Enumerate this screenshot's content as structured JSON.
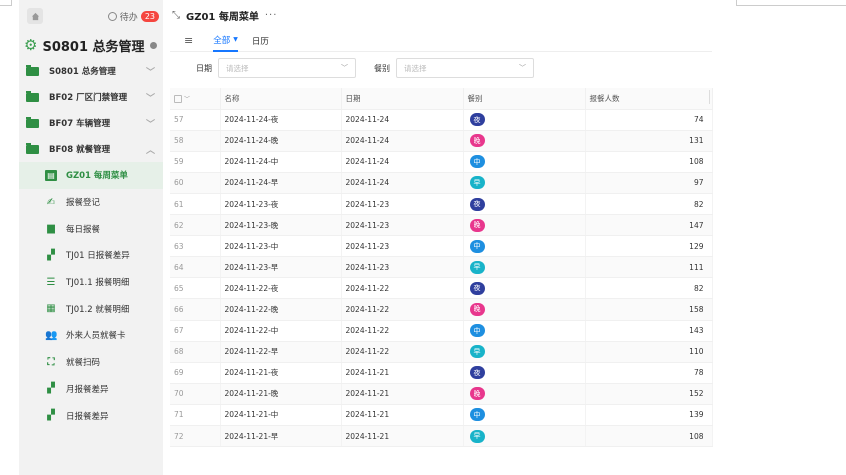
{
  "sidebar": {
    "todo_label": "待办",
    "todo_count": "23",
    "title": "S0801 总务管理",
    "groups": [
      {
        "label": "S0801 总务管理",
        "chevron": "﹀"
      },
      {
        "label": "BF02 厂区门禁管理",
        "chevron": "﹀"
      },
      {
        "label": "BF07 车辆管理",
        "chevron": "﹀"
      },
      {
        "label": "BF08 就餐管理",
        "chevron": "︿"
      }
    ],
    "items": [
      {
        "label": "GZ01 每周菜单",
        "icon": "menu-doc-icon",
        "glyph": "▤"
      },
      {
        "label": "报餐登记",
        "icon": "edit-sign-icon",
        "glyph": "✍"
      },
      {
        "label": "每日报餐",
        "icon": "calendar-box-icon",
        "glyph": "▆"
      },
      {
        "label": "TJ01 日报餐差异",
        "icon": "grid-compare-icon",
        "glyph": "▞"
      },
      {
        "label": "TJ01.1 报餐明细",
        "icon": "list-detail-icon",
        "glyph": "☰"
      },
      {
        "label": "TJ01.2 就餐明细",
        "icon": "table-detail-icon",
        "glyph": "▦"
      },
      {
        "label": "外来人员就餐卡",
        "icon": "visitors-icon",
        "glyph": "👥"
      },
      {
        "label": "就餐扫码",
        "icon": "scan-code-icon",
        "glyph": "⛶"
      },
      {
        "label": "月报餐差异",
        "icon": "month-compare-icon",
        "glyph": "▞"
      },
      {
        "label": "日报餐差异",
        "icon": "day-compare-icon",
        "glyph": "▞"
      }
    ]
  },
  "header": {
    "title": "GZ01 每周菜单",
    "more": "···"
  },
  "tabs": [
    {
      "label": "全部",
      "active": true
    },
    {
      "label": "日历",
      "active": false
    }
  ],
  "filters": {
    "date_label": "日期",
    "date_placeholder": "请选择",
    "meal_label": "餐别",
    "meal_placeholder": "请选择"
  },
  "table": {
    "columns": [
      "名称",
      "日期",
      "餐别",
      "报餐人数"
    ],
    "rows": [
      {
        "no": "57",
        "name": "2024-11-24-夜",
        "date": "2024-11-24",
        "meal": "夜",
        "count": "74"
      },
      {
        "no": "58",
        "name": "2024-11-24-晚",
        "date": "2024-11-24",
        "meal": "晚",
        "count": "131"
      },
      {
        "no": "59",
        "name": "2024-11-24-中",
        "date": "2024-11-24",
        "meal": "中",
        "count": "108"
      },
      {
        "no": "60",
        "name": "2024-11-24-早",
        "date": "2024-11-24",
        "meal": "早",
        "count": "97"
      },
      {
        "no": "61",
        "name": "2024-11-23-夜",
        "date": "2024-11-23",
        "meal": "夜",
        "count": "82"
      },
      {
        "no": "62",
        "name": "2024-11-23-晚",
        "date": "2024-11-23",
        "meal": "晚",
        "count": "147"
      },
      {
        "no": "63",
        "name": "2024-11-23-中",
        "date": "2024-11-23",
        "meal": "中",
        "count": "129"
      },
      {
        "no": "64",
        "name": "2024-11-23-早",
        "date": "2024-11-23",
        "meal": "早",
        "count": "111"
      },
      {
        "no": "65",
        "name": "2024-11-22-夜",
        "date": "2024-11-22",
        "meal": "夜",
        "count": "82"
      },
      {
        "no": "66",
        "name": "2024-11-22-晚",
        "date": "2024-11-22",
        "meal": "晚",
        "count": "158"
      },
      {
        "no": "67",
        "name": "2024-11-22-中",
        "date": "2024-11-22",
        "meal": "中",
        "count": "143"
      },
      {
        "no": "68",
        "name": "2024-11-22-早",
        "date": "2024-11-22",
        "meal": "早",
        "count": "110"
      },
      {
        "no": "69",
        "name": "2024-11-21-夜",
        "date": "2024-11-21",
        "meal": "夜",
        "count": "78"
      },
      {
        "no": "70",
        "name": "2024-11-21-晚",
        "date": "2024-11-21",
        "meal": "晚",
        "count": "152"
      },
      {
        "no": "71",
        "name": "2024-11-21-中",
        "date": "2024-11-21",
        "meal": "中",
        "count": "139"
      },
      {
        "no": "72",
        "name": "2024-11-21-早",
        "date": "2024-11-21",
        "meal": "早",
        "count": "108"
      }
    ]
  },
  "meal_colors": {
    "夜": "#2f3f9e",
    "晚": "#e8378d",
    "中": "#1e8fe0",
    "早": "#18b3c9"
  }
}
